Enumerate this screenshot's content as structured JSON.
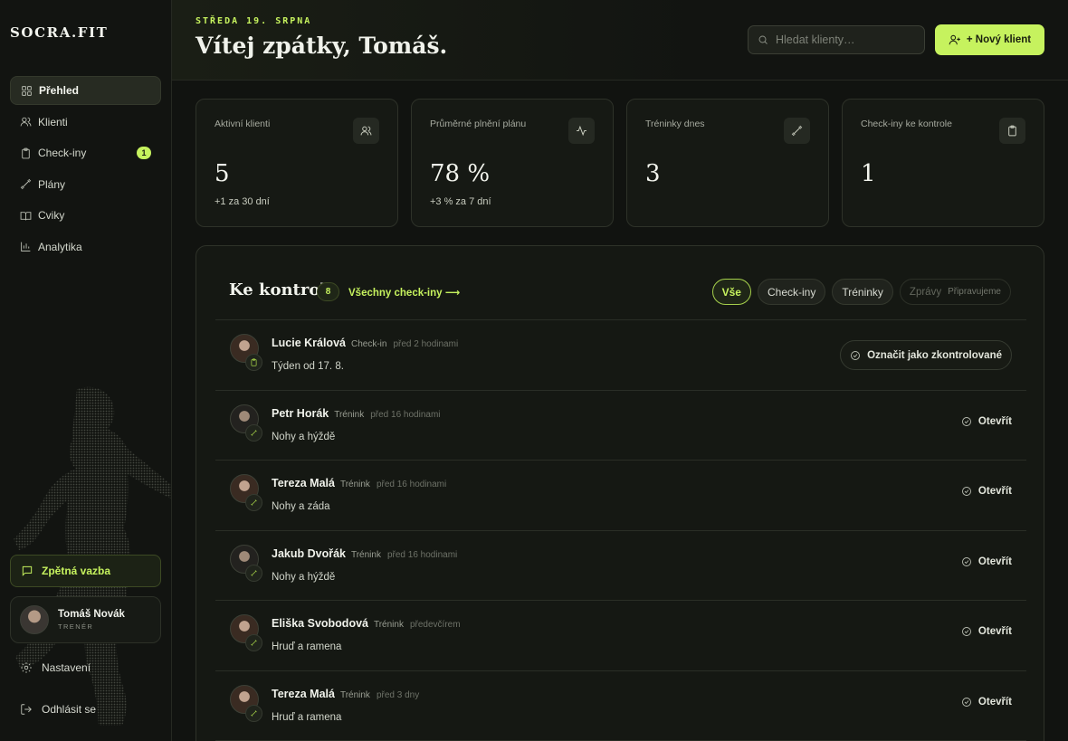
{
  "brand": "SOCRA.FIT",
  "sidebar": {
    "nav": [
      {
        "label": "Přehled",
        "icon": "grid-icon",
        "active": true
      },
      {
        "label": "Klienti",
        "icon": "users-icon"
      },
      {
        "label": "Check-iny",
        "icon": "clipboard-icon",
        "badge": "1"
      },
      {
        "label": "Plány",
        "icon": "dumbbell-icon"
      },
      {
        "label": "Cviky",
        "icon": "book-icon"
      },
      {
        "label": "Analytika",
        "icon": "bar-chart-icon"
      }
    ],
    "feedback": "Zpětná vazba",
    "profile": {
      "name": "Tomáš Novák",
      "role": "TRENÉR"
    },
    "settings": "Nastavení",
    "logout": "Odhlásit se"
  },
  "header": {
    "date": "STŘEDA 19. SRPNA",
    "greeting": "Vítej zpátky, Tomáš.",
    "search_placeholder": "Hledat klienty…",
    "new_client": "+ Nový klient"
  },
  "stats": [
    {
      "label": "Aktivní klienti",
      "value": "5",
      "delta": "+1 za 30 dní",
      "icon": "users-icon"
    },
    {
      "label": "Průměrné plnění plánu",
      "value": "78 %",
      "delta": "+3 % za 7 dní",
      "icon": "activity-icon"
    },
    {
      "label": "Tréninky dnes",
      "value": "3",
      "delta": "",
      "icon": "dumbbell-icon"
    },
    {
      "label": "Check-iny ke kontrole",
      "value": "1",
      "delta": "",
      "icon": "clipboard-icon"
    }
  ],
  "review": {
    "title": "Ke kontrole",
    "count": "8",
    "all_link": "Všechny check-iny ⟶",
    "filters": [
      {
        "label": "Vše",
        "active": true
      },
      {
        "label": "Check-iny"
      },
      {
        "label": "Tréninky"
      },
      {
        "label": "Zprávy",
        "soon": "Připravujeme",
        "disabled": true
      }
    ],
    "items": [
      {
        "name": "Lucie Králová",
        "type": "Check-in",
        "time": "před 2 hodinami",
        "desc": "Týden od 17. 8.",
        "action": "Označit jako zkontrolované",
        "gender": "f"
      },
      {
        "name": "Petr Horák",
        "type": "Trénink",
        "time": "před 16 hodinami",
        "desc": "Nohy a hýždě",
        "action": "Otevřít",
        "gender": "m"
      },
      {
        "name": "Tereza Malá",
        "type": "Trénink",
        "time": "před 16 hodinami",
        "desc": "Nohy a záda",
        "action": "Otevřít",
        "gender": "f"
      },
      {
        "name": "Jakub Dvořák",
        "type": "Trénink",
        "time": "před 16 hodinami",
        "desc": "Nohy a hýždě",
        "action": "Otevřít",
        "gender": "m"
      },
      {
        "name": "Eliška Svobodová",
        "type": "Trénink",
        "time": "předevčírem",
        "desc": "Hruď a ramena",
        "action": "Otevřít",
        "gender": "f"
      },
      {
        "name": "Tereza Malá",
        "type": "Trénink",
        "time": "před 3 dny",
        "desc": "Hruď a ramena",
        "action": "Otevřít",
        "gender": "f"
      }
    ]
  }
}
